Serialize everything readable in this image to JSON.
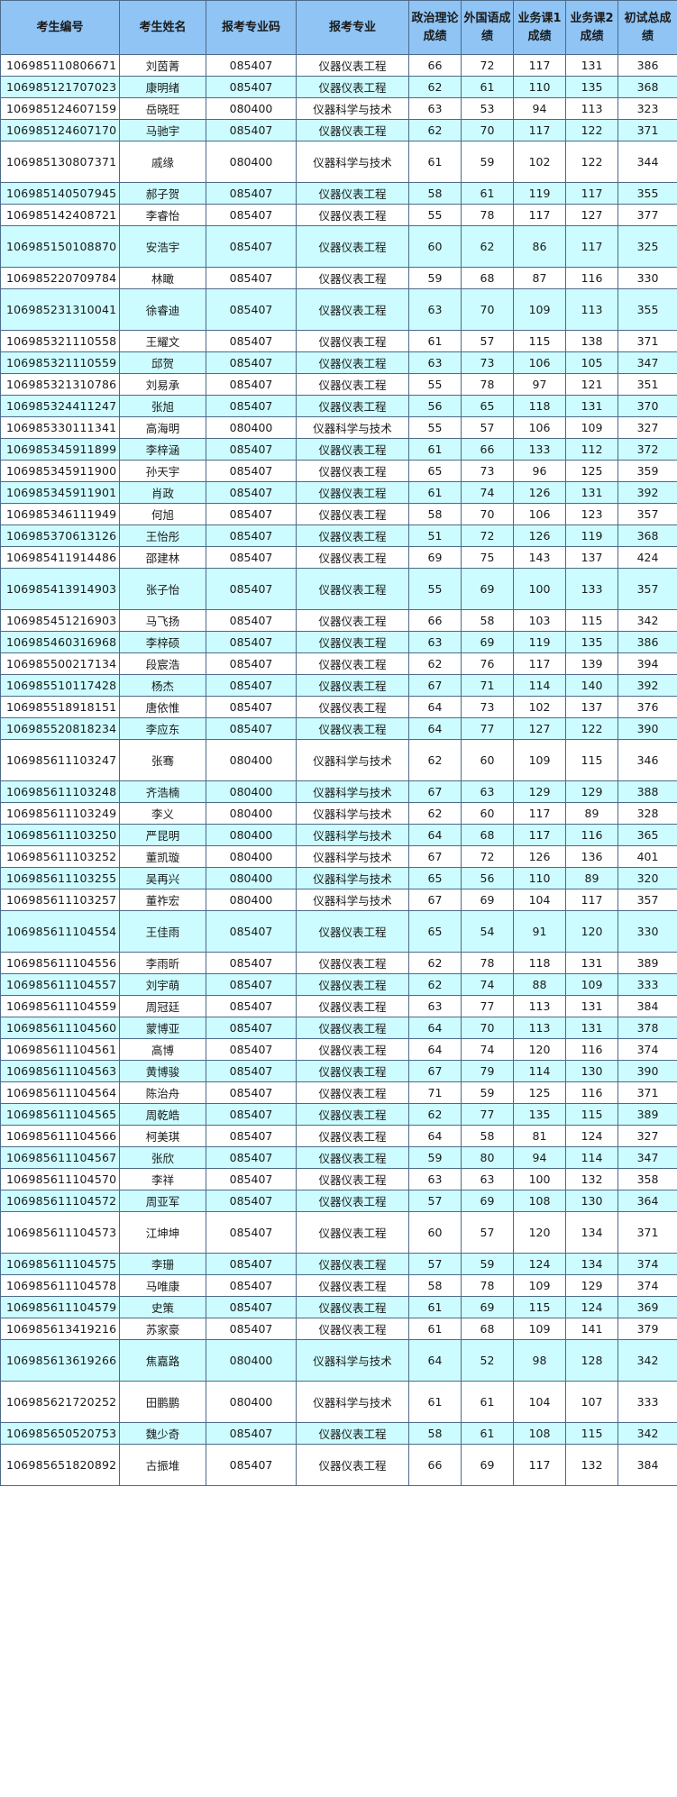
{
  "table": {
    "headers": [
      "考生编号",
      "考生姓名",
      "报考专业码",
      "报考专业",
      "政治理论成绩",
      "外国语成绩",
      "业务课1成绩",
      "业务课2成绩",
      "初试总成绩"
    ],
    "rows": [
      [
        "106985110806671",
        "刘茵菁",
        "085407",
        "仪器仪表工程",
        "66",
        "72",
        "117",
        "131",
        "386"
      ],
      [
        "106985121707023",
        "康明绪",
        "085407",
        "仪器仪表工程",
        "62",
        "61",
        "110",
        "135",
        "368"
      ],
      [
        "106985124607159",
        "岳晓旺",
        "080400",
        "仪器科学与技术",
        "63",
        "53",
        "94",
        "113",
        "323"
      ],
      [
        "106985124607170",
        "马驰宇",
        "085407",
        "仪器仪表工程",
        "62",
        "70",
        "117",
        "122",
        "371"
      ],
      [
        "106985130807371",
        "戚缘",
        "080400",
        "仪器科学与技术",
        "61",
        "59",
        "102",
        "122",
        "344"
      ],
      [
        "106985140507945",
        "郝子贺",
        "085407",
        "仪器仪表工程",
        "58",
        "61",
        "119",
        "117",
        "355"
      ],
      [
        "106985142408721",
        "李睿怡",
        "085407",
        "仪器仪表工程",
        "55",
        "78",
        "117",
        "127",
        "377"
      ],
      [
        "106985150108870",
        "安浩宇",
        "085407",
        "仪器仪表工程",
        "60",
        "62",
        "86",
        "117",
        "325"
      ],
      [
        "106985220709784",
        "林瞰",
        "085407",
        "仪器仪表工程",
        "59",
        "68",
        "87",
        "116",
        "330"
      ],
      [
        "106985231310041",
        "徐睿迪",
        "085407",
        "仪器仪表工程",
        "63",
        "70",
        "109",
        "113",
        "355"
      ],
      [
        "106985321110558",
        "王耀文",
        "085407",
        "仪器仪表工程",
        "61",
        "57",
        "115",
        "138",
        "371"
      ],
      [
        "106985321110559",
        "邱贺",
        "085407",
        "仪器仪表工程",
        "63",
        "73",
        "106",
        "105",
        "347"
      ],
      [
        "106985321310786",
        "刘易承",
        "085407",
        "仪器仪表工程",
        "55",
        "78",
        "97",
        "121",
        "351"
      ],
      [
        "106985324411247",
        "张旭",
        "085407",
        "仪器仪表工程",
        "56",
        "65",
        "118",
        "131",
        "370"
      ],
      [
        "106985330111341",
        "高海明",
        "080400",
        "仪器科学与技术",
        "55",
        "57",
        "106",
        "109",
        "327"
      ],
      [
        "106985345911899",
        "李梓涵",
        "085407",
        "仪器仪表工程",
        "61",
        "66",
        "133",
        "112",
        "372"
      ],
      [
        "106985345911900",
        "孙天宇",
        "085407",
        "仪器仪表工程",
        "65",
        "73",
        "96",
        "125",
        "359"
      ],
      [
        "106985345911901",
        "肖政",
        "085407",
        "仪器仪表工程",
        "61",
        "74",
        "126",
        "131",
        "392"
      ],
      [
        "106985346111949",
        "何旭",
        "085407",
        "仪器仪表工程",
        "58",
        "70",
        "106",
        "123",
        "357"
      ],
      [
        "106985370613126",
        "王怡彤",
        "085407",
        "仪器仪表工程",
        "51",
        "72",
        "126",
        "119",
        "368"
      ],
      [
        "106985411914486",
        "邵建林",
        "085407",
        "仪器仪表工程",
        "69",
        "75",
        "143",
        "137",
        "424"
      ],
      [
        "106985413914903",
        "张子怡",
        "085407",
        "仪器仪表工程",
        "55",
        "69",
        "100",
        "133",
        "357"
      ],
      [
        "106985451216903",
        "马飞扬",
        "085407",
        "仪器仪表工程",
        "66",
        "58",
        "103",
        "115",
        "342"
      ],
      [
        "106985460316968",
        "李梓硕",
        "085407",
        "仪器仪表工程",
        "63",
        "69",
        "119",
        "135",
        "386"
      ],
      [
        "106985500217134",
        "段宸浩",
        "085407",
        "仪器仪表工程",
        "62",
        "76",
        "117",
        "139",
        "394"
      ],
      [
        "106985510117428",
        "杨杰",
        "085407",
        "仪器仪表工程",
        "67",
        "71",
        "114",
        "140",
        "392"
      ],
      [
        "106985518918151",
        "唐依惟",
        "085407",
        "仪器仪表工程",
        "64",
        "73",
        "102",
        "137",
        "376"
      ],
      [
        "106985520818234",
        "李应东",
        "085407",
        "仪器仪表工程",
        "64",
        "77",
        "127",
        "122",
        "390"
      ],
      [
        "106985611103247",
        "张骞",
        "080400",
        "仪器科学与技术",
        "62",
        "60",
        "109",
        "115",
        "346"
      ],
      [
        "106985611103248",
        "齐浩楠",
        "080400",
        "仪器科学与技术",
        "67",
        "63",
        "129",
        "129",
        "388"
      ],
      [
        "106985611103249",
        "李义",
        "080400",
        "仪器科学与技术",
        "62",
        "60",
        "117",
        "89",
        "328"
      ],
      [
        "106985611103250",
        "严昆明",
        "080400",
        "仪器科学与技术",
        "64",
        "68",
        "117",
        "116",
        "365"
      ],
      [
        "106985611103252",
        "董凯璇",
        "080400",
        "仪器科学与技术",
        "67",
        "72",
        "126",
        "136",
        "401"
      ],
      [
        "106985611103255",
        "吴再兴",
        "080400",
        "仪器科学与技术",
        "65",
        "56",
        "110",
        "89",
        "320"
      ],
      [
        "106985611103257",
        "董祚宏",
        "080400",
        "仪器科学与技术",
        "67",
        "69",
        "104",
        "117",
        "357"
      ],
      [
        "106985611104554",
        "王佳雨",
        "085407",
        "仪器仪表工程",
        "65",
        "54",
        "91",
        "120",
        "330"
      ],
      [
        "106985611104556",
        "李雨昕",
        "085407",
        "仪器仪表工程",
        "62",
        "78",
        "118",
        "131",
        "389"
      ],
      [
        "106985611104557",
        "刘宇萌",
        "085407",
        "仪器仪表工程",
        "62",
        "74",
        "88",
        "109",
        "333"
      ],
      [
        "106985611104559",
        "周冠廷",
        "085407",
        "仪器仪表工程",
        "63",
        "77",
        "113",
        "131",
        "384"
      ],
      [
        "106985611104560",
        "蒙博亚",
        "085407",
        "仪器仪表工程",
        "64",
        "70",
        "113",
        "131",
        "378"
      ],
      [
        "106985611104561",
        "高博",
        "085407",
        "仪器仪表工程",
        "64",
        "74",
        "120",
        "116",
        "374"
      ],
      [
        "106985611104563",
        "黄博骏",
        "085407",
        "仪器仪表工程",
        "67",
        "79",
        "114",
        "130",
        "390"
      ],
      [
        "106985611104564",
        "陈治舟",
        "085407",
        "仪器仪表工程",
        "71",
        "59",
        "125",
        "116",
        "371"
      ],
      [
        "106985611104565",
        "周乾皓",
        "085407",
        "仪器仪表工程",
        "62",
        "77",
        "135",
        "115",
        "389"
      ],
      [
        "106985611104566",
        "柯美琪",
        "085407",
        "仪器仪表工程",
        "64",
        "58",
        "81",
        "124",
        "327"
      ],
      [
        "106985611104567",
        "张欣",
        "085407",
        "仪器仪表工程",
        "59",
        "80",
        "94",
        "114",
        "347"
      ],
      [
        "106985611104570",
        "李祥",
        "085407",
        "仪器仪表工程",
        "63",
        "63",
        "100",
        "132",
        "358"
      ],
      [
        "106985611104572",
        "周亚军",
        "085407",
        "仪器仪表工程",
        "57",
        "69",
        "108",
        "130",
        "364"
      ],
      [
        "106985611104573",
        "江坤坤",
        "085407",
        "仪器仪表工程",
        "60",
        "57",
        "120",
        "134",
        "371"
      ],
      [
        "106985611104575",
        "李珊",
        "085407",
        "仪器仪表工程",
        "57",
        "59",
        "124",
        "134",
        "374"
      ],
      [
        "106985611104578",
        "马唯康",
        "085407",
        "仪器仪表工程",
        "58",
        "78",
        "109",
        "129",
        "374"
      ],
      [
        "106985611104579",
        "史策",
        "085407",
        "仪器仪表工程",
        "61",
        "69",
        "115",
        "124",
        "369"
      ],
      [
        "106985613419216",
        "苏家豪",
        "085407",
        "仪器仪表工程",
        "61",
        "68",
        "109",
        "141",
        "379"
      ],
      [
        "106985613619266",
        "焦嘉路",
        "080400",
        "仪器科学与技术",
        "64",
        "52",
        "98",
        "128",
        "342"
      ],
      [
        "106985621720252",
        "田鹏鹏",
        "080400",
        "仪器科学与技术",
        "61",
        "61",
        "104",
        "107",
        "333"
      ],
      [
        "106985650520753",
        "魏少奇",
        "085407",
        "仪器仪表工程",
        "58",
        "61",
        "108",
        "115",
        "342"
      ],
      [
        "106985651820892",
        "古振堆",
        "085407",
        "仪器仪表工程",
        "66",
        "69",
        "117",
        "132",
        "384"
      ]
    ]
  }
}
